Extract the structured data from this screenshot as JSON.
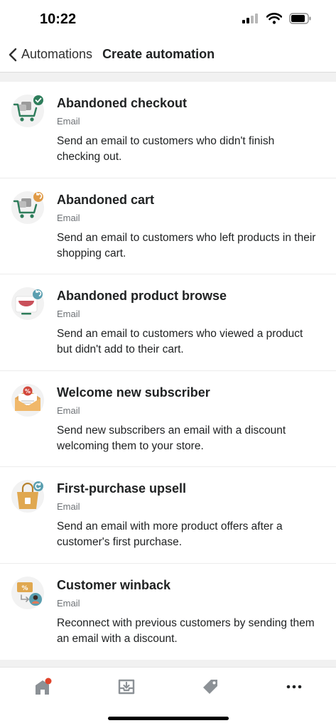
{
  "status_bar": {
    "time": "10:22"
  },
  "nav": {
    "back_label": "Automations",
    "title": "Create automation"
  },
  "automations": [
    {
      "title": "Abandoned checkout",
      "channel": "Email",
      "description": "Send an email to customers who didn't finish checking out.",
      "icon": "checkout-cart-icon"
    },
    {
      "title": "Abandoned cart",
      "channel": "Email",
      "description": "Send an email to customers who left products in their shopping cart.",
      "icon": "abandoned-cart-icon"
    },
    {
      "title": "Abandoned product browse",
      "channel": "Email",
      "description": "Send an email to customers who viewed a product but didn't add to their cart.",
      "icon": "product-browse-icon"
    },
    {
      "title": "Welcome new subscriber",
      "channel": "Email",
      "description": "Send new subscribers an email with a discount welcoming them to your store.",
      "icon": "discount-envelope-icon"
    },
    {
      "title": "First-purchase upsell",
      "channel": "Email",
      "description": "Send an email with more product offers after a customer's first purchase.",
      "icon": "shopping-bag-icon"
    },
    {
      "title": "Customer winback",
      "channel": "Email",
      "description": "Reconnect with previous customers by sending them an email with a discount.",
      "icon": "winback-discount-icon"
    }
  ],
  "tab_bar": {
    "tabs": [
      "home-icon",
      "inbox-icon",
      "tag-icon",
      "more-icon"
    ],
    "notification_dot_color": "#e0442b"
  },
  "colors": {
    "accent_green": "#2e7d5b",
    "accent_orange": "#e09a46",
    "accent_teal": "#5a9fb0"
  }
}
